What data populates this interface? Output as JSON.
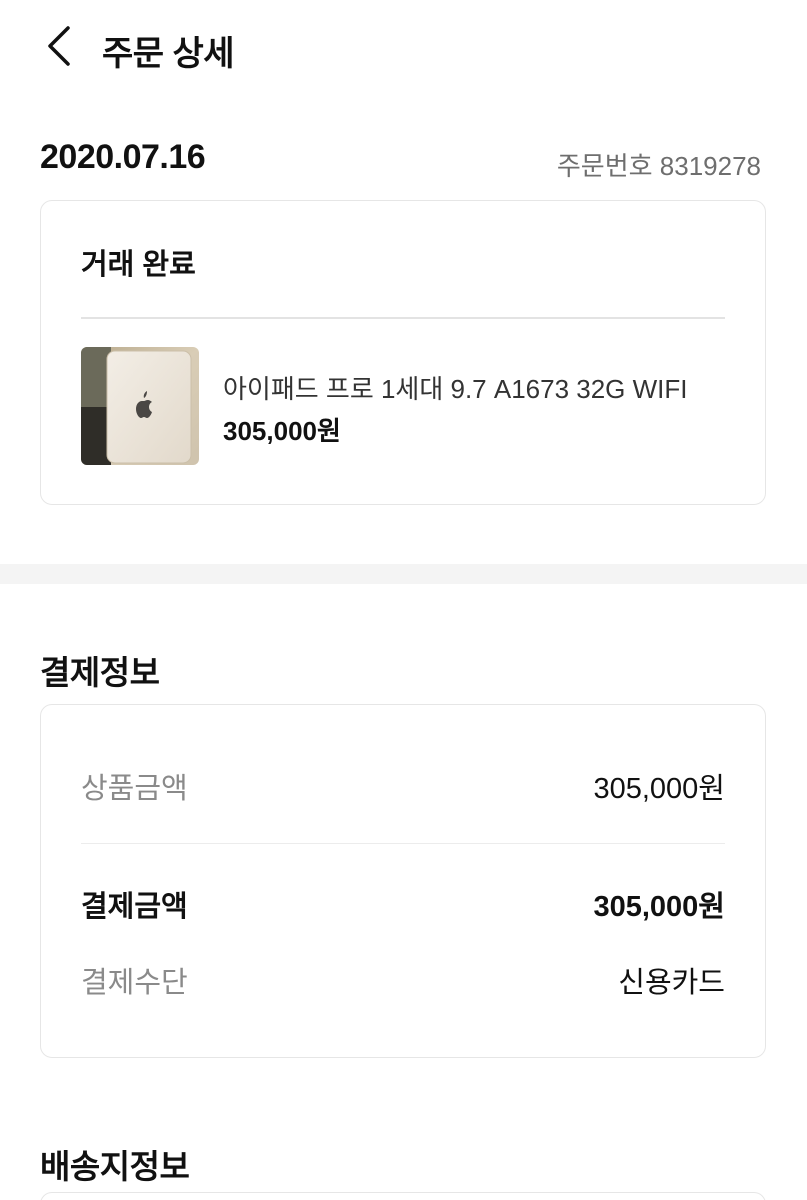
{
  "header": {
    "title": "주문 상세",
    "back_icon": "chevron-left-icon"
  },
  "order": {
    "date": "2020.07.16",
    "number_text": "주문번호 8319278"
  },
  "status_card": {
    "status": "거래 완료",
    "product": {
      "name": "아이패드 프로 1세대 9.7 A1673 32G WIFI",
      "price": "305,000원",
      "thumbnail_icon": "apple-logo-icon"
    }
  },
  "payment": {
    "section_title": "결제정보",
    "rows": [
      {
        "label": "상품금액",
        "value": "305,000원"
      },
      {
        "label": "결제금액",
        "value": "305,000원"
      },
      {
        "label": "결제수단",
        "value": "신용카드"
      }
    ]
  },
  "shipping": {
    "section_title": "배송지정보"
  },
  "colors": {
    "text_primary": "#111111",
    "text_secondary": "#8a8a8a",
    "border": "#e6e6e6",
    "band": "#f4f4f4"
  }
}
